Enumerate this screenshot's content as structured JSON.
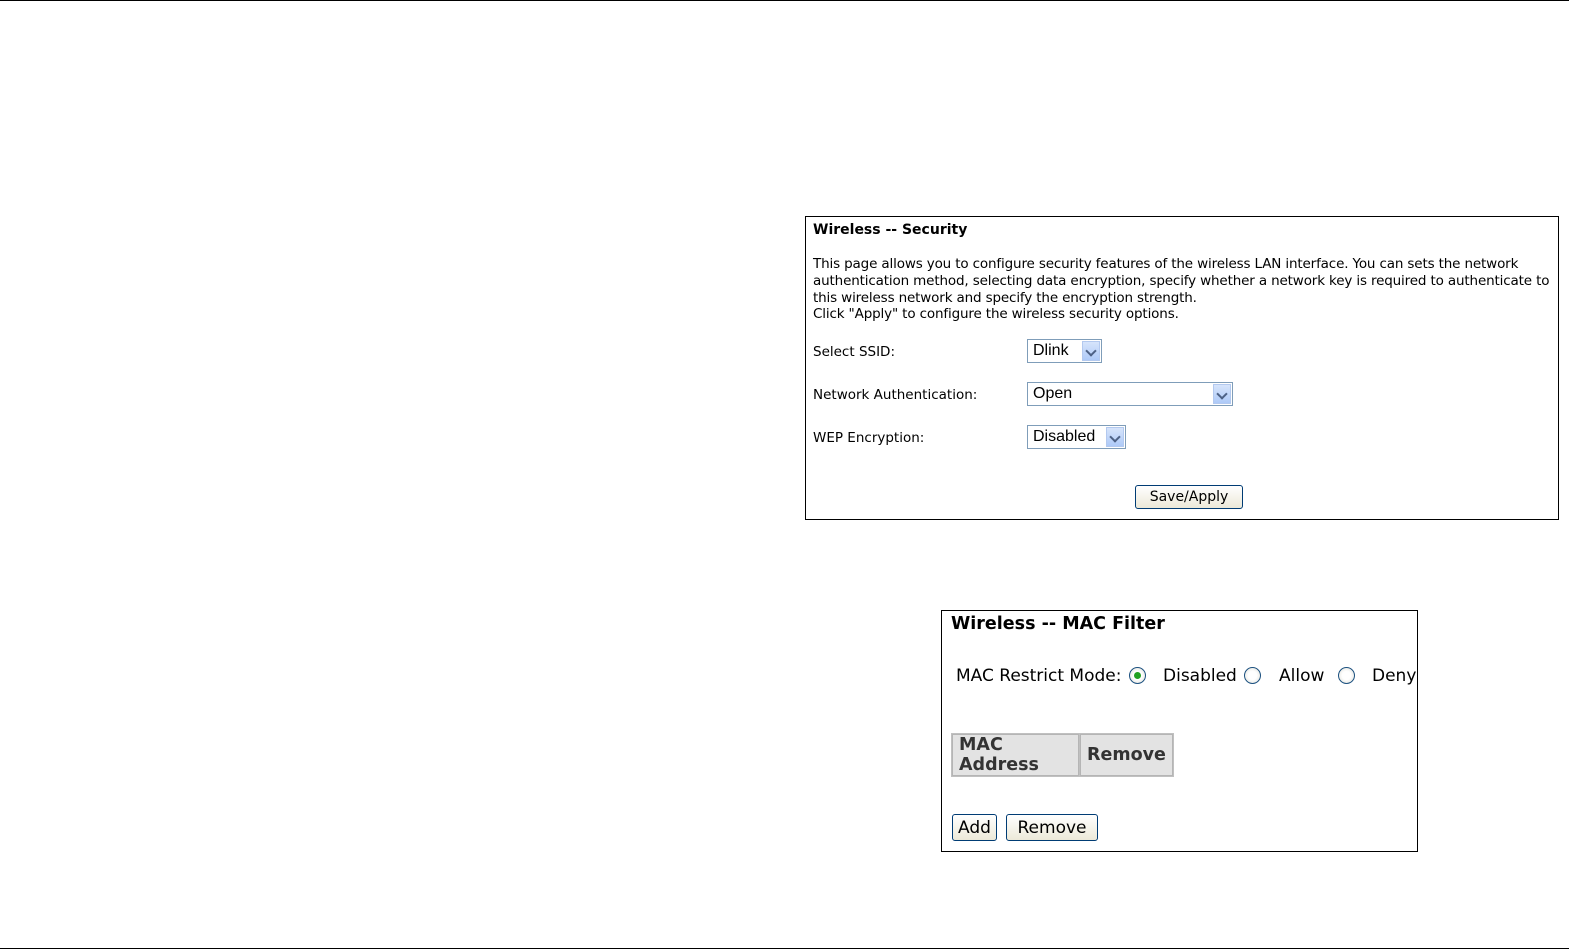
{
  "security": {
    "title": "Wireless -- Security",
    "description": [
      "This page allows you to configure security features of the wireless LAN interface. You can sets the network",
      "authentication method, selecting data encryption, specify whether a network key is required to authenticate to",
      "this wireless network and specify the encryption strength.",
      "Click \"Apply\" to configure the wireless security options."
    ],
    "ssid_label": "Select SSID:",
    "ssid_value": "Dlink",
    "auth_label": "Network Authentication:",
    "auth_value": "Open",
    "wep_label": "WEP Encryption:",
    "wep_value": "Disabled",
    "save_label": "Save/Apply"
  },
  "mac_filter": {
    "title": "Wireless -- MAC Filter",
    "mode_label": "MAC Restrict Mode:",
    "options": [
      "Disabled",
      "Allow",
      "Deny"
    ],
    "selected": "Disabled",
    "columns": [
      "MAC Address",
      "Remove"
    ],
    "add_label": "Add",
    "remove_label": "Remove"
  }
}
